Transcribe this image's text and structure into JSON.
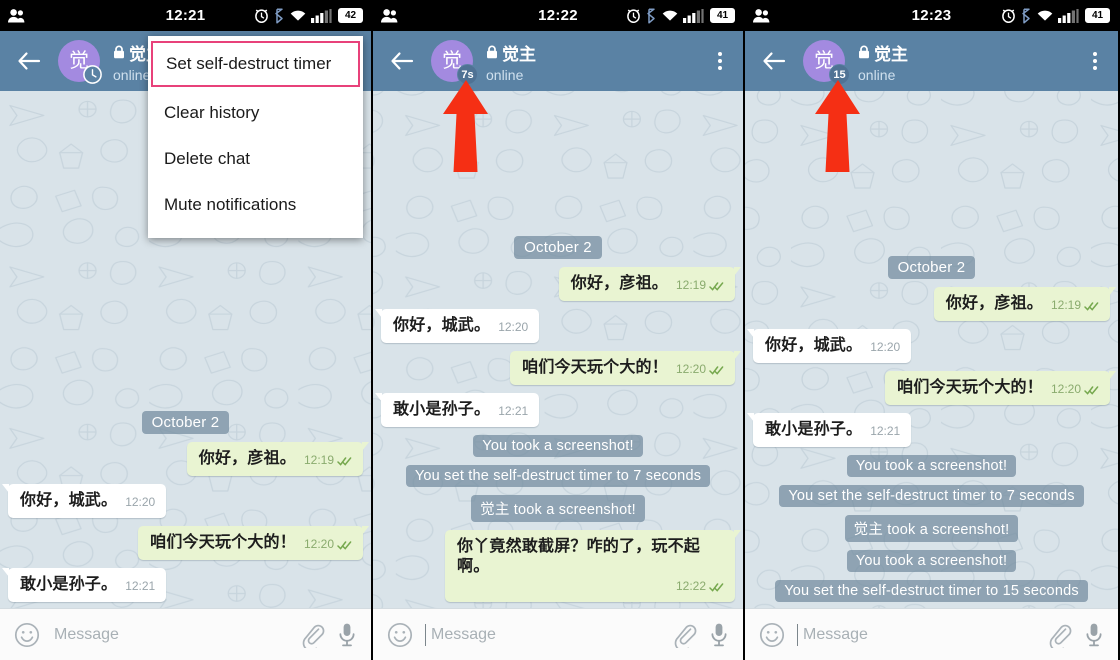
{
  "colors": {
    "header_bar": "#5a82a4",
    "chat_background": "#d9e3e9",
    "outgoing_bubble": "#e9f4d2",
    "incoming_bubble": "#ffffff",
    "service_chip": "#728b9e",
    "avatar": "#a38ae0",
    "highlight_outline": "#e8417a",
    "annotation_arrow": "#f52f14"
  },
  "panels": [
    {
      "id": "panel-1",
      "status_bar": {
        "contacts_icon": "contacts-icon",
        "clock": "12:21",
        "alarm_icon": "alarm-icon",
        "bluetooth_icon": "bluetooth-icon",
        "wifi_icon": "wifi-icon",
        "signal_icon": "signal-icon",
        "battery_level": "42"
      },
      "header": {
        "back_icon": "back-arrow-icon",
        "avatar_letter": "觉",
        "timer_badge": "clock-icon",
        "lock_icon": "lock-icon",
        "title": "觉主",
        "status": "online",
        "overflow_icon": "overflow-menu-icon"
      },
      "menu": {
        "items": [
          {
            "label": "Set self-destruct timer",
            "highlighted": true
          },
          {
            "label": "Clear history",
            "highlighted": false
          },
          {
            "label": "Delete chat",
            "highlighted": false
          },
          {
            "label": "Mute notifications",
            "highlighted": false
          }
        ]
      },
      "messages": [
        {
          "kind": "date",
          "text": "October 2"
        },
        {
          "kind": "out",
          "text": "你好，彦祖。",
          "time": "12:19",
          "ticks": true
        },
        {
          "kind": "in",
          "text": "你好，城武。",
          "time": "12:20",
          "ticks": false
        },
        {
          "kind": "out",
          "text": "咱们今天玩个大的！",
          "time": "12:20",
          "ticks": true
        },
        {
          "kind": "in",
          "text": "敢小是孙子。",
          "time": "12:21",
          "ticks": false
        }
      ],
      "composer": {
        "smiley_icon": "smiley-icon",
        "placeholder": "Message",
        "value": "",
        "show_caret": false,
        "attach_icon": "paperclip-icon",
        "voice_icon": "microphone-icon"
      },
      "annotation_arrow": false
    },
    {
      "id": "panel-2",
      "status_bar": {
        "contacts_icon": "contacts-icon",
        "clock": "12:22",
        "alarm_icon": "alarm-icon",
        "bluetooth_icon": "bluetooth-icon",
        "wifi_icon": "wifi-icon",
        "signal_icon": "signal-icon",
        "battery_level": "41"
      },
      "header": {
        "back_icon": "back-arrow-icon",
        "avatar_letter": "觉",
        "timer_badge": "7s",
        "lock_icon": "lock-icon",
        "title": "觉主",
        "status": "online",
        "overflow_icon": "overflow-menu-icon"
      },
      "menu": null,
      "messages": [
        {
          "kind": "date",
          "text": "October 2"
        },
        {
          "kind": "out",
          "text": "你好，彦祖。",
          "time": "12:19",
          "ticks": true
        },
        {
          "kind": "in",
          "text": "你好，城武。",
          "time": "12:20",
          "ticks": false
        },
        {
          "kind": "out",
          "text": "咱们今天玩个大的！",
          "time": "12:20",
          "ticks": true
        },
        {
          "kind": "in",
          "text": "敢小是孙子。",
          "time": "12:21",
          "ticks": false
        },
        {
          "kind": "service",
          "text": "You took a screenshot!"
        },
        {
          "kind": "service",
          "text": "You set the self-destruct timer to 7 seconds"
        },
        {
          "kind": "service",
          "text": "觉主 took a screenshot!"
        },
        {
          "kind": "out-wrap",
          "text": "你丫竟然敢截屏？咋的了，玩不起啊。",
          "time": "12:22",
          "ticks": true
        }
      ],
      "composer": {
        "smiley_icon": "smiley-icon",
        "placeholder": "Message",
        "value": "",
        "show_caret": true,
        "attach_icon": "paperclip-icon",
        "voice_icon": "microphone-icon"
      },
      "annotation_arrow": true
    },
    {
      "id": "panel-3",
      "status_bar": {
        "contacts_icon": "contacts-icon",
        "clock": "12:23",
        "alarm_icon": "alarm-icon",
        "bluetooth_icon": "bluetooth-icon",
        "wifi_icon": "wifi-icon",
        "signal_icon": "signal-icon",
        "battery_level": "41"
      },
      "header": {
        "back_icon": "back-arrow-icon",
        "avatar_letter": "觉",
        "timer_badge": "15",
        "lock_icon": "lock-icon",
        "title": "觉主",
        "status": "online",
        "overflow_icon": "overflow-menu-icon"
      },
      "menu": null,
      "messages": [
        {
          "kind": "date",
          "text": "October 2"
        },
        {
          "kind": "out",
          "text": "你好，彦祖。",
          "time": "12:19",
          "ticks": true
        },
        {
          "kind": "in",
          "text": "你好，城武。",
          "time": "12:20",
          "ticks": false
        },
        {
          "kind": "out",
          "text": "咱们今天玩个大的！",
          "time": "12:20",
          "ticks": true
        },
        {
          "kind": "in",
          "text": "敢小是孙子。",
          "time": "12:21",
          "ticks": false
        },
        {
          "kind": "service",
          "text": "You took a screenshot!"
        },
        {
          "kind": "service",
          "text": "You set the self-destruct timer to 7 seconds"
        },
        {
          "kind": "service",
          "text": "觉主 took a screenshot!"
        },
        {
          "kind": "service",
          "text": "You took a screenshot!"
        },
        {
          "kind": "service",
          "text": "You set the self-destruct timer to 15 seconds"
        }
      ],
      "composer": {
        "smiley_icon": "smiley-icon",
        "placeholder": "Message",
        "value": "",
        "show_caret": true,
        "attach_icon": "paperclip-icon",
        "voice_icon": "microphone-icon"
      },
      "annotation_arrow": true
    }
  ]
}
